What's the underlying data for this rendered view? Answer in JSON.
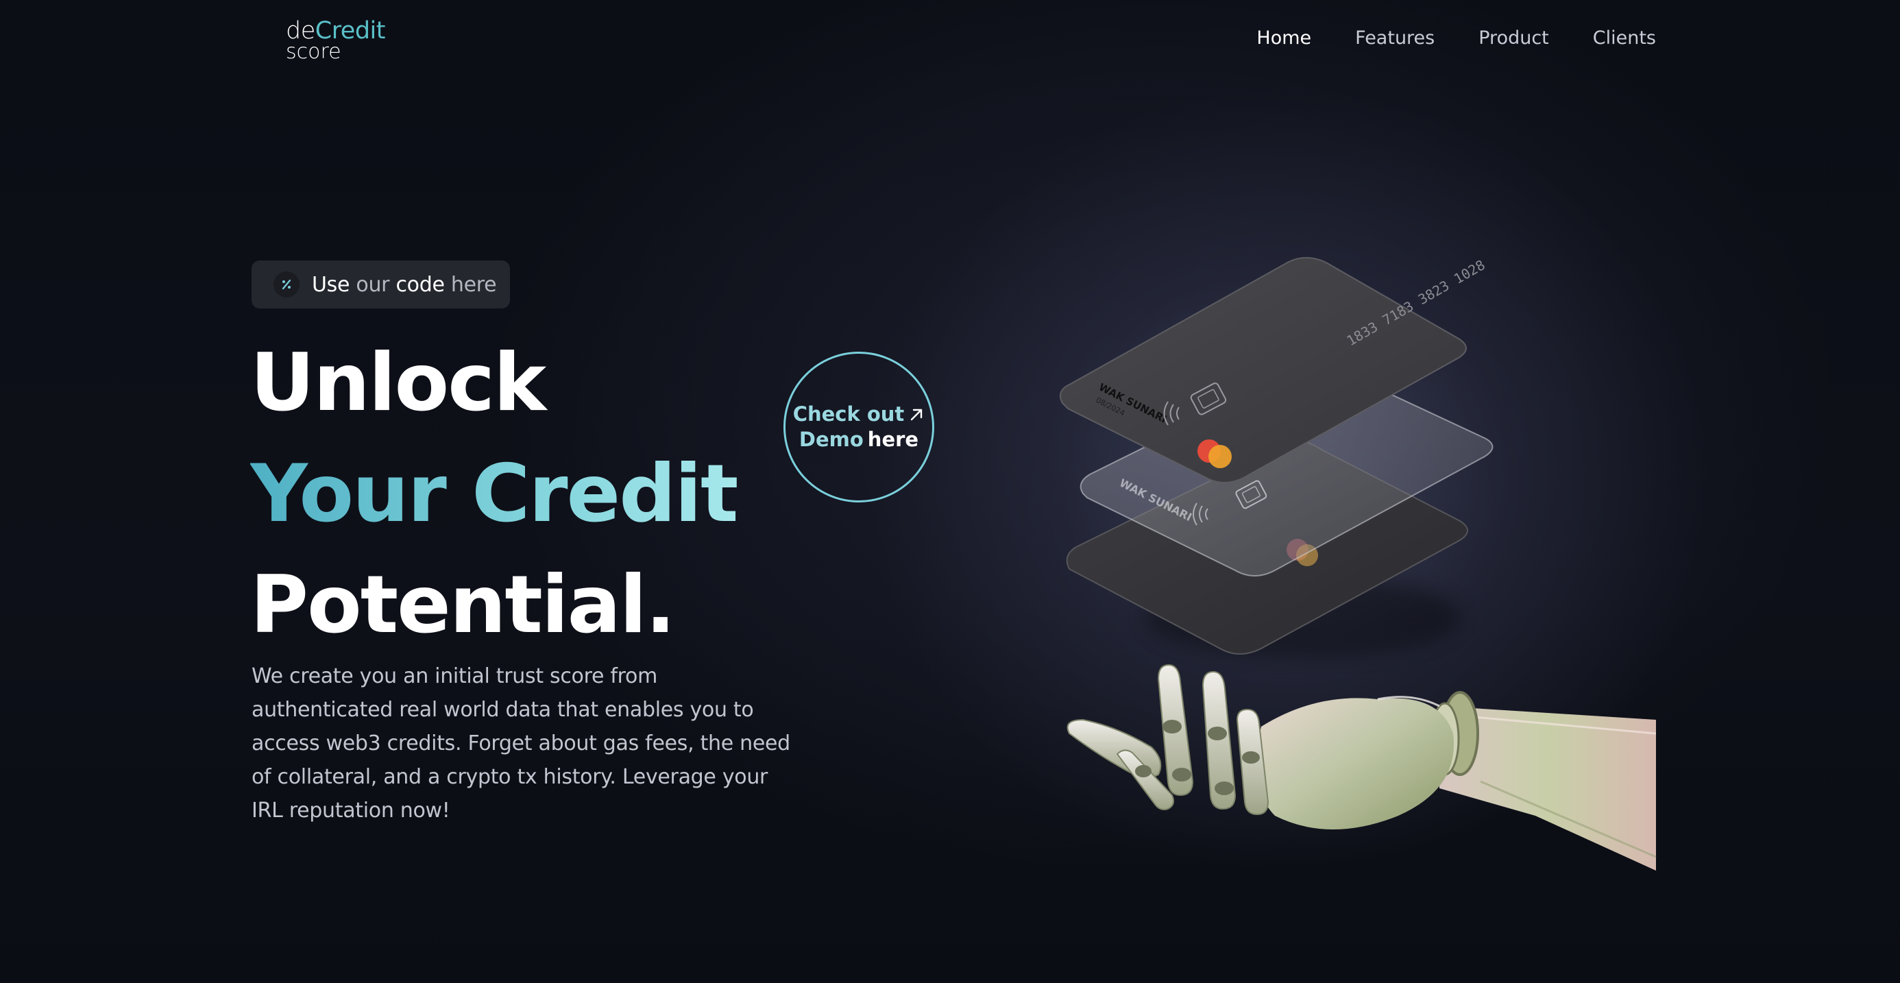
{
  "logo": {
    "part1": "de",
    "part2": "Credit",
    "part3": "score"
  },
  "nav": {
    "items": [
      {
        "label": "Home",
        "active": true
      },
      {
        "label": "Features",
        "active": false
      },
      {
        "label": "Product",
        "active": false
      },
      {
        "label": "Clients",
        "active": false
      }
    ]
  },
  "promo": {
    "w1": "Use",
    "g1": "our",
    "w2": "code",
    "g2": "here",
    "icon": "percent-icon"
  },
  "hero": {
    "line1": "Unlock",
    "line2": "Your Credit",
    "line3": "Potential.",
    "description": "We create you an initial trust score from authenticated real world data that enables you to access web3 credits. Forget about gas fees, the need of collateral, and a crypto tx history. Leverage your IRL reputation now!"
  },
  "demo": {
    "line1": "Check out",
    "line2a": "Demo",
    "line2b": "here",
    "icon": "arrow-up-right-icon"
  },
  "cards": {
    "number": "1833 7183 3823 1028",
    "holder": "WAK SUNARI",
    "expiry": "08/2024"
  },
  "colors": {
    "accent": "#5ac0c8",
    "accent_light": "#7ad0dc",
    "background": "#0e1019",
    "pill": "#25272e",
    "text_muted": "#c3c6d0"
  }
}
